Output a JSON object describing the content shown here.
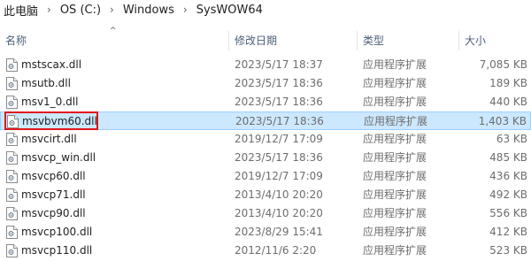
{
  "breadcrumb": [
    {
      "label": "此电脑"
    },
    {
      "label": "OS (C:)"
    },
    {
      "label": "Windows"
    },
    {
      "label": "SysWOW64"
    }
  ],
  "columns": {
    "name": "名称",
    "date": "修改日期",
    "type": "类型",
    "size": "大小"
  },
  "files": [
    {
      "name": "mstscax.dll",
      "date": "2023/5/17 18:37",
      "type": "应用程序扩展",
      "size": "7,085 KB"
    },
    {
      "name": "msutb.dll",
      "date": "2023/5/17 18:36",
      "type": "应用程序扩展",
      "size": "189 KB"
    },
    {
      "name": "msv1_0.dll",
      "date": "2023/5/17 18:36",
      "type": "应用程序扩展",
      "size": "440 KB"
    },
    {
      "name": "msvbvm60.dll",
      "date": "2023/5/17 18:36",
      "type": "应用程序扩展",
      "size": "1,403 KB",
      "selected": true
    },
    {
      "name": "msvcirt.dll",
      "date": "2019/12/7 17:09",
      "type": "应用程序扩展",
      "size": "63 KB"
    },
    {
      "name": "msvcp_win.dll",
      "date": "2023/5/17 18:36",
      "type": "应用程序扩展",
      "size": "485 KB"
    },
    {
      "name": "msvcp60.dll",
      "date": "2019/12/7 17:09",
      "type": "应用程序扩展",
      "size": "436 KB"
    },
    {
      "name": "msvcp71.dll",
      "date": "2013/4/10 20:20",
      "type": "应用程序扩展",
      "size": "492 KB"
    },
    {
      "name": "msvcp90.dll",
      "date": "2013/4/10 20:20",
      "type": "应用程序扩展",
      "size": "556 KB"
    },
    {
      "name": "msvcp100.dll",
      "date": "2023/8/29 15:41",
      "type": "应用程序扩展",
      "size": "412 KB"
    },
    {
      "name": "msvcp110.dll",
      "date": "2012/11/6 2:20",
      "type": "应用程序扩展",
      "size": "523 KB"
    }
  ],
  "colors": {
    "selection_bg": "#cce8ff",
    "selection_border": "#99d1ff",
    "highlight": "#e0191c"
  }
}
